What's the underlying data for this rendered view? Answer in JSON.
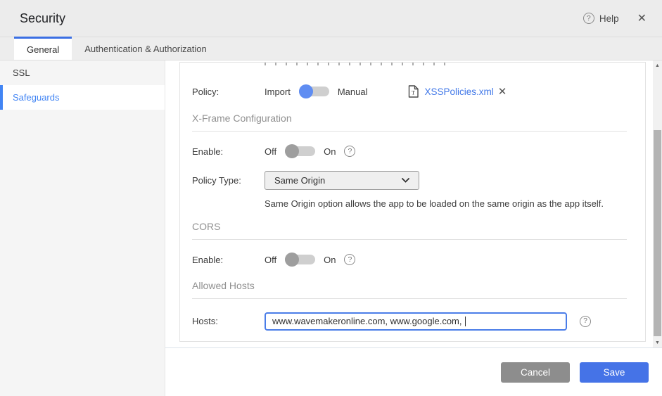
{
  "header": {
    "title": "Security",
    "help_label": "Help"
  },
  "icons": {
    "help": "?",
    "close": "✕",
    "remove": "✕",
    "scroll_up": "▲",
    "scroll_down": "▼"
  },
  "tabs": [
    {
      "label": "General",
      "active": true
    },
    {
      "label": "Authentication & Authorization",
      "active": false
    }
  ],
  "sidebar": {
    "items": [
      {
        "label": "SSL",
        "selected": false
      },
      {
        "label": "Safeguards",
        "selected": true
      }
    ]
  },
  "form": {
    "policy": {
      "label": "Policy:",
      "options": [
        "Import",
        "Manual"
      ],
      "selected": "Import",
      "file": {
        "name": "XSSPolicies.xml"
      }
    },
    "xframe": {
      "heading": "X-Frame Configuration",
      "enable_label": "Enable:",
      "off": "Off",
      "on": "On",
      "enabled": false,
      "policy_type": {
        "label": "Policy Type:",
        "value": "Same Origin"
      },
      "help_text": "Same Origin option allows the app to be loaded on the same origin as the app itself."
    },
    "cors": {
      "heading": "CORS",
      "enable_label": "Enable:",
      "off": "Off",
      "on": "On",
      "enabled": false
    },
    "allowed_hosts": {
      "heading": "Allowed Hosts",
      "hosts_label": "Hosts:",
      "value": "www.wavemakeronline.com, www.google.com, "
    }
  },
  "footer": {
    "cancel_label": "Cancel",
    "save_label": "Save"
  },
  "colors": {
    "accent_tab": "#3b6fe3",
    "selected_nav": "#4285f4",
    "link": "#4178e8",
    "toggle_on_knob": "#5f8df2",
    "toggle_off_knob": "#9e9e9e",
    "toggle_track": "#cfcfcf",
    "save_button": "#4573e7",
    "cancel_button": "#8d8d8d"
  }
}
